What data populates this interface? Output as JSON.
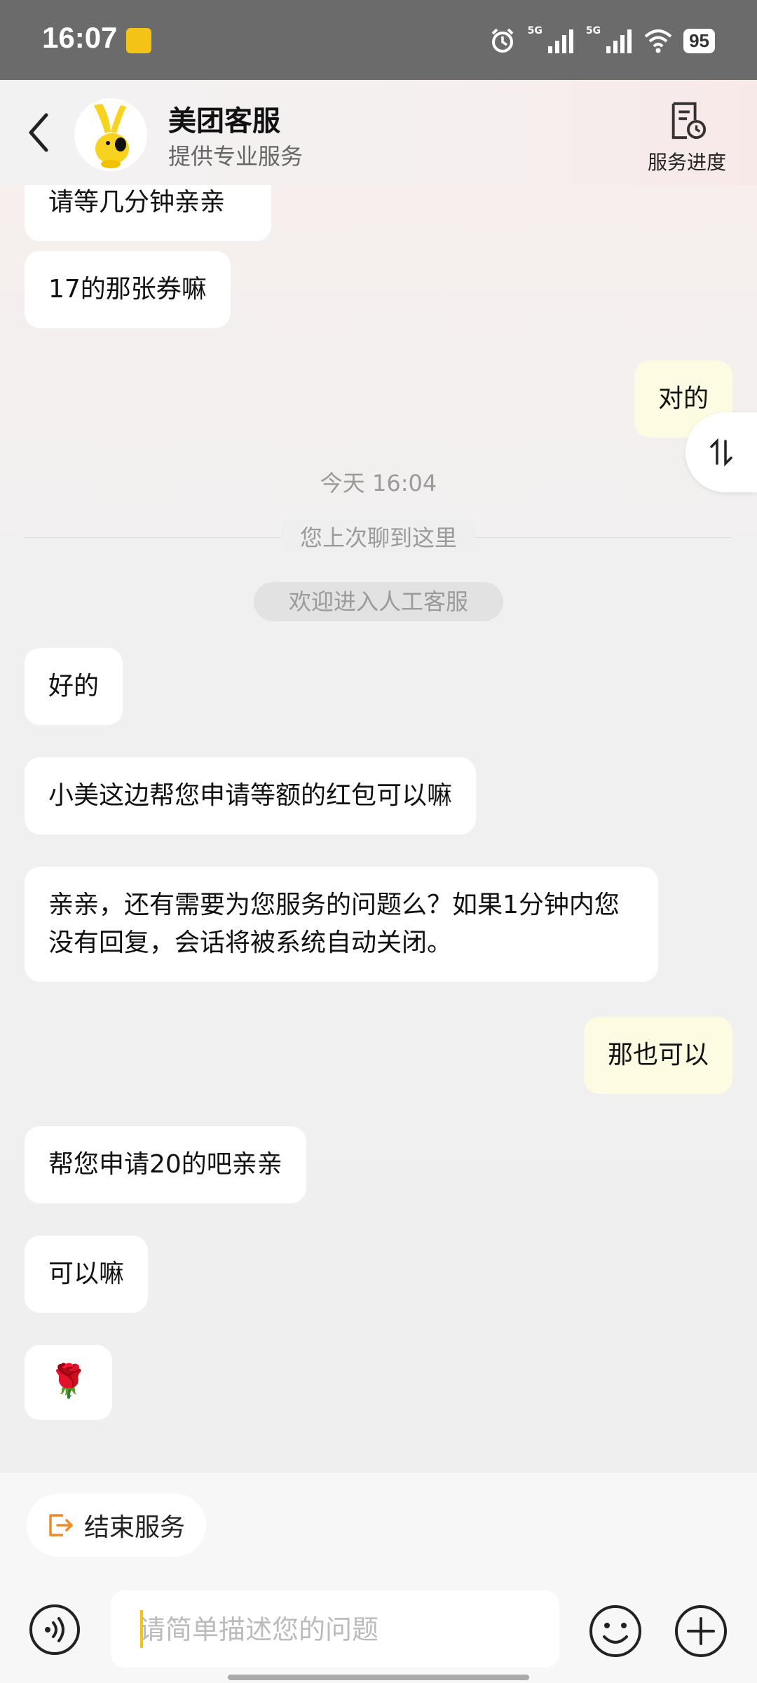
{
  "status_bar": {
    "time": "16:07",
    "network_1": "5G",
    "network_2": "5G",
    "battery": "95",
    "icons": [
      "alarm-icon",
      "signal-icon",
      "signal-icon",
      "wifi-icon",
      "battery-icon"
    ]
  },
  "header": {
    "title": "美团客服",
    "subtitle": "提供专业服务",
    "progress_label": "服务进度"
  },
  "messages": [
    {
      "side": "left",
      "text": "请等几分钟亲亲"
    },
    {
      "side": "left",
      "text": "17的那张券嘛"
    },
    {
      "side": "right",
      "text": "对的"
    },
    {
      "type": "timestamp",
      "text": "今天 16:04"
    },
    {
      "type": "divider",
      "text": "您上次聊到这里"
    },
    {
      "type": "system",
      "text": "欢迎进入人工客服"
    },
    {
      "side": "left",
      "text": "好的"
    },
    {
      "side": "left",
      "text": "小美这边帮您申请等额的红包可以嘛"
    },
    {
      "side": "left",
      "text": "亲亲，还有需要为您服务的问题么？如果1分钟内您没有回复，会话将被系统自动关闭。"
    },
    {
      "side": "right",
      "text": "那也可以"
    },
    {
      "side": "left",
      "text": "帮您申请20的吧亲亲"
    },
    {
      "side": "left",
      "text": "可以嘛"
    },
    {
      "side": "left",
      "emoji": "🌹"
    }
  ],
  "bottom": {
    "end_service_label": "结束服务",
    "input_placeholder": "请简单描述您的问题"
  },
  "colors": {
    "brand_yellow": "#f3c417",
    "own_bubble": "#fefbe3",
    "end_icon": "#f08a24"
  }
}
